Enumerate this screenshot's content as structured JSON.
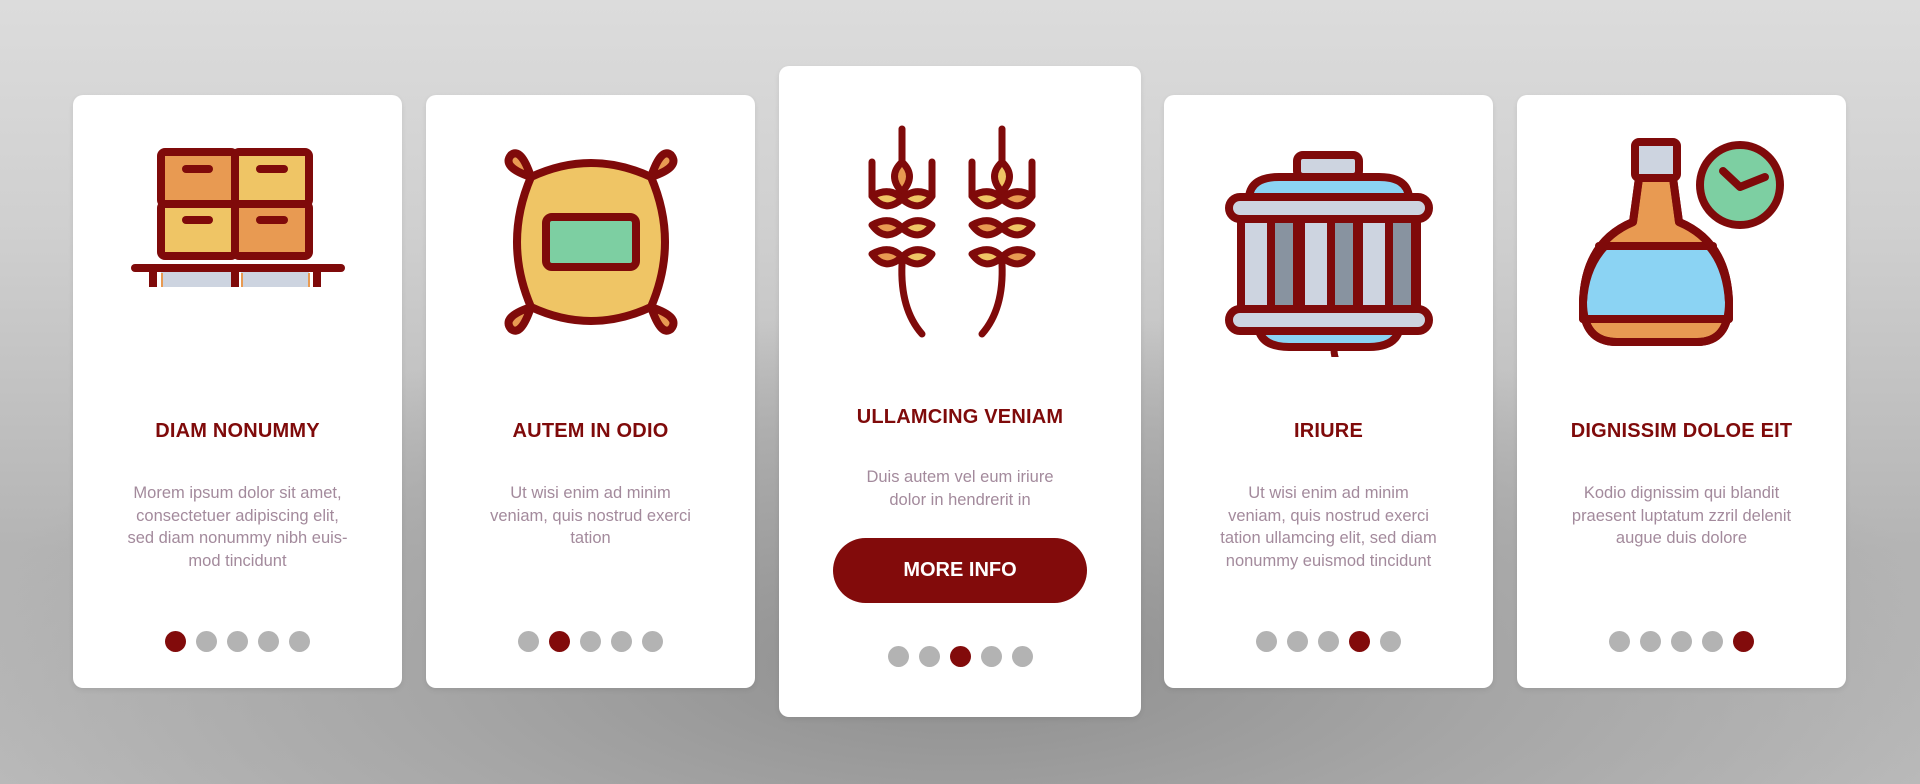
{
  "colors": {
    "accent": "#820b0b",
    "title": "#7f0a0a",
    "description": "#a38a9c",
    "dot_inactive": "#b3b3b3",
    "card_bg": "#ffffff"
  },
  "cards": [
    {
      "icon": "pallet-boxes-icon",
      "title": "DIAM NONUMMY",
      "description": "Morem ipsum dolor sit amet, consectetuer adipiscing elit, sed diam nonummy nibh euis- mod tincidunt",
      "lines": [
        "Morem ipsum dolor sit amet,",
        "consectetuer adipiscing elit,",
        "sed diam nonummy nibh euis-",
        "mod tincidunt"
      ],
      "active_dot": 1,
      "dot_count": 5
    },
    {
      "icon": "grain-sack-icon",
      "title": "AUTEM IN ODIO",
      "lines": [
        "Ut wisi enim ad minim",
        "veniam, quis nostrud exerci",
        "tation"
      ],
      "active_dot": 2,
      "dot_count": 5
    },
    {
      "icon": "wheat-ears-icon",
      "title": "ULLAMCING VENIAM",
      "lines": [
        "Duis autem vel eum iriure",
        "dolor in hendrerit in"
      ],
      "button_label": "MORE INFO",
      "active_dot": 3,
      "dot_count": 5
    },
    {
      "icon": "fermentation-tank-icon",
      "title": "IRIURE",
      "lines": [
        "Ut wisi enim ad minim",
        "veniam, quis nostrud exerci",
        "tation ullamcing elit, sed diam",
        "nonummy euismod tincidunt"
      ],
      "active_dot": 4,
      "dot_count": 5
    },
    {
      "icon": "bottle-clock-icon",
      "title": "DIGNISSIM DOLOE EIT",
      "lines": [
        "Kodio dignissim qui blandit",
        "praesent luptatum zzril delenit",
        "augue duis dolore"
      ],
      "active_dot": 5,
      "dot_count": 5
    }
  ]
}
